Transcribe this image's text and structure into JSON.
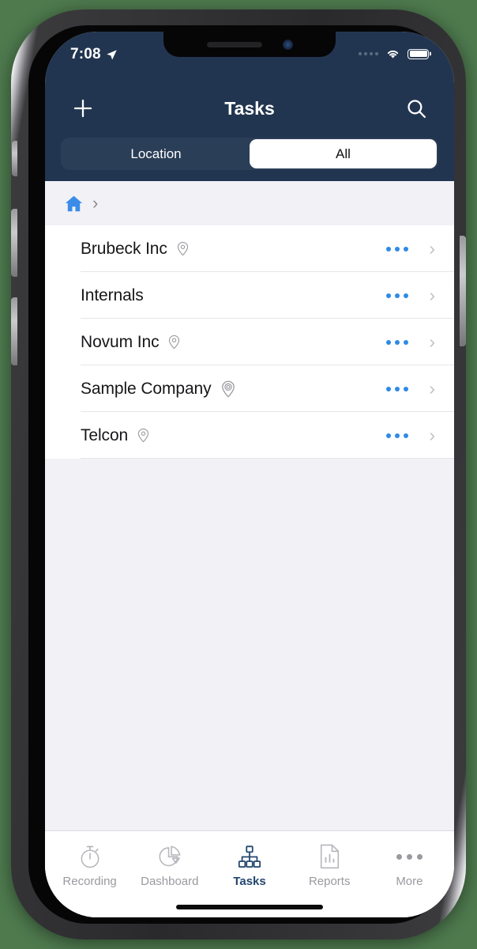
{
  "status_bar": {
    "time": "7:08",
    "location_icon": "location-arrow-icon",
    "signal_icon": "cellular-dots-icon",
    "wifi_icon": "wifi-icon",
    "battery_icon": "battery-full-icon"
  },
  "nav": {
    "title": "Tasks",
    "add_icon": "plus-icon",
    "search_icon": "search-icon"
  },
  "segmented": {
    "options": [
      {
        "label": "Location",
        "selected": false
      },
      {
        "label": "All",
        "selected": true
      }
    ]
  },
  "breadcrumb": {
    "home_icon": "home-icon",
    "separator": "›"
  },
  "list": {
    "rows": [
      {
        "name": "Brubeck Inc",
        "pin_icon": "map-pin-icon",
        "has_pin": true,
        "pin_style": "plain",
        "more_icon": "more-dots-icon",
        "chevron": "›"
      },
      {
        "name": "Internals",
        "pin_icon": "",
        "has_pin": false,
        "pin_style": "",
        "more_icon": "more-dots-icon",
        "chevron": "›"
      },
      {
        "name": "Novum Inc",
        "pin_icon": "map-pin-icon",
        "has_pin": true,
        "pin_style": "plain",
        "more_icon": "more-dots-icon",
        "chevron": "›"
      },
      {
        "name": "Sample Company",
        "pin_icon": "map-pin-circled-icon",
        "has_pin": true,
        "pin_style": "circled",
        "more_icon": "more-dots-icon",
        "chevron": "›"
      },
      {
        "name": "Telcon",
        "pin_icon": "map-pin-icon",
        "has_pin": true,
        "pin_style": "plain",
        "more_icon": "more-dots-icon",
        "chevron": "›"
      }
    ]
  },
  "tabbar": {
    "tabs": [
      {
        "label": "Recording",
        "icon": "stopwatch-icon",
        "active": false
      },
      {
        "label": "Dashboard",
        "icon": "pie-chart-icon",
        "active": false
      },
      {
        "label": "Tasks",
        "icon": "org-chart-icon",
        "active": true
      },
      {
        "label": "Reports",
        "icon": "document-bar-chart-icon",
        "active": false
      },
      {
        "label": "More",
        "icon": "more-dots-icon",
        "active": false
      }
    ]
  },
  "colors": {
    "navy": "#223550",
    "segment_track": "#2b3e58",
    "accent_blue": "#2e8ae6",
    "home_blue": "#3b8ce8",
    "tab_active": "#24486f",
    "tab_inactive": "#9a9aa0",
    "page_bg": "#f1f1f6",
    "row_bg": "#ffffff",
    "frame_bg": "#4e7a4e"
  }
}
